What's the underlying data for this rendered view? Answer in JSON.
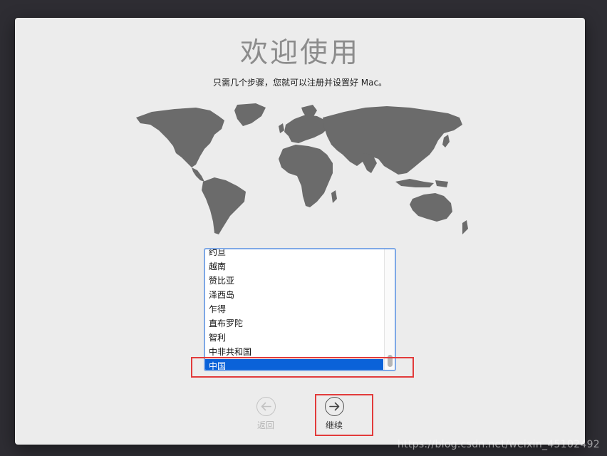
{
  "window": {
    "title": "欢迎使用",
    "subtitle": "只需几个步骤，您就可以注册并设置好 Mac。"
  },
  "country_list": {
    "items": [
      "约旦",
      "越南",
      "赞比亚",
      "泽西岛",
      "乍得",
      "直布罗陀",
      "智利",
      "中非共和国",
      "中国"
    ],
    "selected": "中国"
  },
  "nav": {
    "back_label": "返回",
    "continue_label": "继续"
  },
  "watermark": "https://blog.csdn.net/weixin_45102492",
  "colors": {
    "selection": "#0a62d9",
    "highlight_box": "#e23b3b",
    "map_land": "#6b6b6b"
  }
}
